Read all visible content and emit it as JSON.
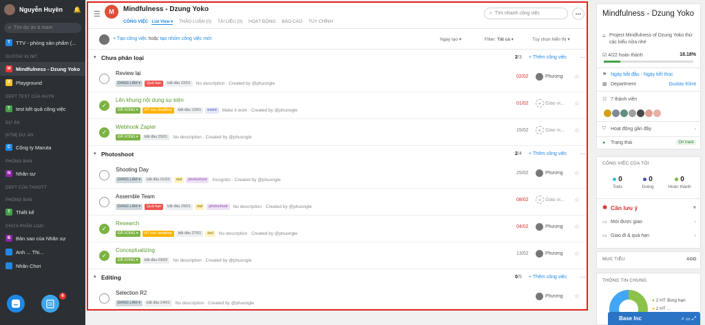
{
  "sidebar": {
    "user": "Nguyễn Huyền",
    "search_placeholder": "Tìm dự án & team",
    "items": [
      {
        "type": "item",
        "label": "TTV - phòng sản phẩm (...",
        "badge": "T",
        "color": "#1e88e5"
      },
      {
        "type": "section",
        "label": "GUSTAV KLIMT"
      },
      {
        "type": "item",
        "label": "Mindfulness - Dzung Yoko",
        "badge": "M",
        "color": "#e53935",
        "active": true
      },
      {
        "type": "item",
        "label": "Playground",
        "badge": "P",
        "color": "#fbc02d"
      },
      {
        "type": "section",
        "label": "DEPT TEST CỦA HUYN"
      },
      {
        "type": "item",
        "label": "test kết quả công việc",
        "badge": "T",
        "color": "#43a047"
      },
      {
        "type": "section",
        "label": "DỰ ÁN"
      },
      {
        "type": "section",
        "label": "[KTM] DỰ ÁN"
      },
      {
        "type": "item",
        "label": "Công ty Maruta",
        "badge": "C",
        "color": "#1e88e5"
      },
      {
        "type": "section",
        "label": "PHÒNG BAN"
      },
      {
        "type": "item",
        "label": "Nhân sự",
        "badge": "N",
        "color": "#8e24aa"
      },
      {
        "type": "section",
        "label": "DEPT CỦA THAOTT"
      },
      {
        "type": "section",
        "label": "PHÒNG BAN"
      },
      {
        "type": "item",
        "label": "Thiết kế",
        "badge": "T",
        "color": "#43a047"
      },
      {
        "type": "section",
        "label": "CHƯA PHÂN LOẠI"
      },
      {
        "type": "item",
        "label": "Bản sao của Nhân sự",
        "badge": "B",
        "color": "#8e24aa"
      },
      {
        "type": "item",
        "label": "Anh ... Thi...",
        "badge": "",
        "color": "#1e88e5"
      },
      {
        "type": "item",
        "label": "Nhân Chơi",
        "badge": "",
        "color": "#1e88e5"
      }
    ],
    "notif_count": "6"
  },
  "header": {
    "logo_letter": "M",
    "title": "Mindfulness - Dzung Yoko",
    "tabs": [
      "CÔNG VIỆC",
      "THẢO LUẬN (0)",
      "TÀI LIỆU (0)",
      "HOẠT ĐỘNG",
      "BÁO CÁO",
      "TÙY CHỈNH"
    ],
    "subview": "List View",
    "search_placeholder": "Tìm nhanh công việc"
  },
  "toolbar": {
    "create_link": "Tạo công việc",
    "create_mid": " hoặc ",
    "create_group": "tạo nhóm công việc mới",
    "sort": "Ngày tạo",
    "filter_label": "Filter: ",
    "filter_value": "Tất cả",
    "display": "Tùy chọn hiển thị"
  },
  "sections": [
    {
      "title": "Chưa phân loại",
      "done": "2",
      "total": "/3",
      "add": "Thêm công việc",
      "tasks": [
        {
          "name": "Review lại",
          "done": false,
          "tags": [
            [
              "ĐANG LÀM",
              "dl"
            ],
            [
              "Quá hạn",
              "qh"
            ],
            [
              "bắt đầu 22/01",
              "date"
            ]
          ],
          "meta": "No description · Created by @phuongle",
          "date": "02/02",
          "date_red": true,
          "assignee": "Phương",
          "avatar": true
        },
        {
          "name": "Lên khung nội dung sự kiện",
          "done": true,
          "tags": [
            [
              "ĐÃ XONG",
              "dx"
            ],
            [
              "HT sau deadline",
              "ht"
            ],
            [
              "bắt đầu 13/01",
              "date"
            ],
            [
              "event",
              "event"
            ]
          ],
          "meta": "Make it work · Created by @phuongle",
          "date": "01/02",
          "date_red": true,
          "assignee": "Giao vi...",
          "avatar": false
        },
        {
          "name": "Webhook Zapier",
          "done": true,
          "tags": [
            [
              "ĐÃ XONG",
              "dx"
            ],
            [
              "bắt đầu 25/01",
              "date"
            ]
          ],
          "meta": "No description · Created by @phuongle",
          "date": "15/02",
          "date_red": false,
          "assignee": "Giao vi...",
          "avatar": false
        }
      ]
    },
    {
      "title": "Photoshoot",
      "done": "2",
      "total": "/4",
      "add": "Thêm công việc",
      "tasks": [
        {
          "name": "Shooting Day",
          "done": false,
          "tags": [
            [
              "ĐANG LÀM",
              "dl"
            ],
            [
              "bắt đầu 01/02",
              "date"
            ],
            [
              "dail",
              "dail"
            ],
            [
              "photoshoot",
              "ps"
            ]
          ],
          "meta": "Incognito · Created by @phuongle",
          "date": "25/02",
          "date_red": false,
          "assignee": "Phương",
          "avatar": true
        },
        {
          "name": "Assemble Team",
          "done": false,
          "tags": [
            [
              "ĐANG LÀM",
              "dl"
            ],
            [
              "Quá hạn",
              "qh"
            ],
            [
              "bắt đầu 29/01",
              "date"
            ],
            [
              "dail",
              "dail"
            ],
            [
              "photoshoot",
              "ps"
            ]
          ],
          "meta": "No description · Created by @phuongle",
          "date": "08/02",
          "date_red": true,
          "assignee": "Giao vi...",
          "avatar": false
        },
        {
          "name": "Research",
          "done": true,
          "tags": [
            [
              "ĐÃ XONG",
              "dx"
            ],
            [
              "HT sau deadline",
              "ht"
            ],
            [
              "bắt đầu 27/01",
              "date"
            ],
            [
              "dail",
              "dail"
            ]
          ],
          "meta": "No description · Created by @phuongle",
          "date": "04/02",
          "date_red": true,
          "assignee": "Phương",
          "avatar": true
        },
        {
          "name": "Conceptualizing",
          "done": true,
          "tags": [
            [
              "ĐÃ XONG",
              "dx"
            ],
            [
              "bắt đầu 03/02",
              "date"
            ]
          ],
          "meta": "No description · Created by @phuongle",
          "date": "13/02",
          "date_red": false,
          "assignee": "Phương",
          "avatar": true
        }
      ]
    },
    {
      "title": "Editing",
      "done": "0",
      "total": "/5",
      "add": "Thêm công việc",
      "tasks": [
        {
          "name": "Selection R2",
          "done": false,
          "tags": [
            [
              "ĐANG LÀM",
              "dl"
            ],
            [
              "bắt đầu 24/01",
              "date"
            ]
          ],
          "meta": "No description · Created by @phuongle",
          "date": "",
          "date_red": false,
          "assignee": "Phương",
          "avatar": true
        }
      ]
    }
  ],
  "panel": {
    "title": "Mindfulness - Dzung Yoko",
    "desc": "Project Mindfulness of Dzung Yoko thử các kiểu nữa nhé",
    "progress_text": "4/22 hoàn thành",
    "progress_pct": "18.18%",
    "progress_value": 0.1818,
    "dates": "Ngày bắt đầu - Ngày kết thúc",
    "department_label": "Department",
    "department_value": "Gustav Klimt",
    "members": "7 thành viên",
    "activity": "Hoạt động gần đây",
    "status_label": "Trạng thái",
    "status_value": "On track",
    "my_tasks": "CÔNG VIỆC CỦA TÔI",
    "todo_n": "0",
    "todo_l": "Todo",
    "doing_n": "0",
    "doing_l": "Doing",
    "done_n": "0",
    "done_l": "Hoàn thành",
    "attention": "Cần lưu ý",
    "new_assigned": "Mới được giao",
    "overdue": "Giao đi & quá hạn",
    "goals": "MỤC TIÊU",
    "goals_add": "ADD",
    "general": "THÔNG TIN CHUNG",
    "legend1": "2 HT đúng hạn",
    "legend2": "2 HT ..."
  },
  "chat": {
    "label": "Base Inc"
  }
}
